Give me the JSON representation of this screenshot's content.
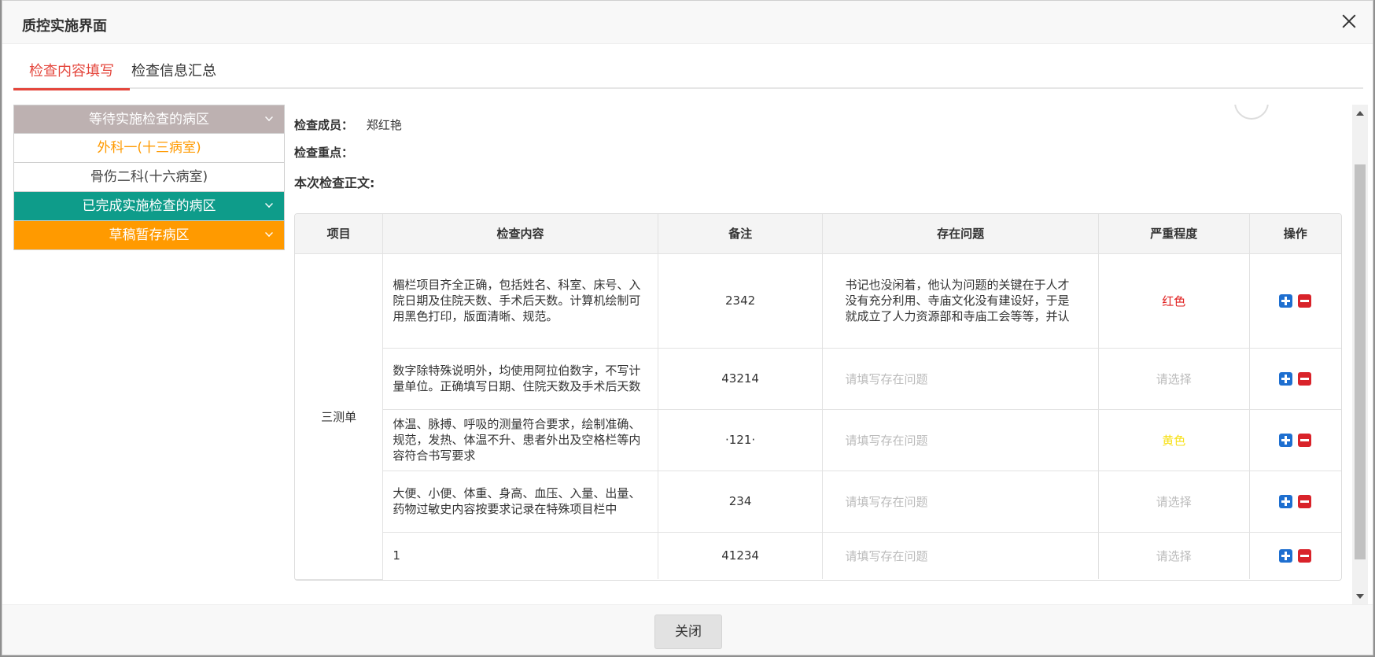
{
  "dialog": {
    "title": "质控实施界面",
    "close_label": "关闭"
  },
  "tabs": [
    {
      "label": "检查内容填写",
      "active": true
    },
    {
      "label": "检查信息汇总",
      "active": false
    }
  ],
  "sidebar": {
    "pending_group": "等待实施检查的病区",
    "pending_items": [
      "外科一(十三病室)",
      "骨伤二科(十六病室)"
    ],
    "done_group": "已完成实施检查的病区",
    "draft_group": "草稿暂存病区"
  },
  "form": {
    "member_label": "检查成员：",
    "member_value": "郑红艳",
    "focus_label": "检查重点：",
    "body_label": "本次检查正文:"
  },
  "table": {
    "headers": [
      "项目",
      "检查内容",
      "备注",
      "存在问题",
      "严重程度",
      "操作"
    ],
    "group_label": "三测单",
    "issue_placeholder": "请填写存在问题",
    "severity_placeholder": "请选择",
    "rows": [
      {
        "content": "楣栏项目齐全正确，包括姓名、科室、床号、入院日期及住院天数、手术后天数。计算机绘制可用黑色打印，版面清晰、规范。",
        "remark": "2342",
        "issue": "书记也没闲着，他认为问题的关键在于人才没有充分利用、寺庙文化没有建设好，于是就成立了人力资源部和寺庙工会等等，并认",
        "severity": "红色"
      },
      {
        "content": "数字除特殊说明外，均使用阿拉伯数字，不写计量单位。正确填写日期、住院天数及手术后天数",
        "remark": "43214",
        "issue": "",
        "severity": ""
      },
      {
        "content": "体温、脉搏、呼吸的测量符合要求，绘制准确、规范，发热、体温不升、患者外出及空格栏等内容符合书写要求",
        "remark": "·121·",
        "issue": "",
        "severity": "黄色"
      },
      {
        "content": "大便、小便、体重、身高、血压、入量、出量、药物过敏史内容按要求记录在特殊项目栏中",
        "remark": "234",
        "issue": "",
        "severity": ""
      },
      {
        "content": "1",
        "remark": "41234",
        "issue": "",
        "severity": ""
      }
    ]
  }
}
